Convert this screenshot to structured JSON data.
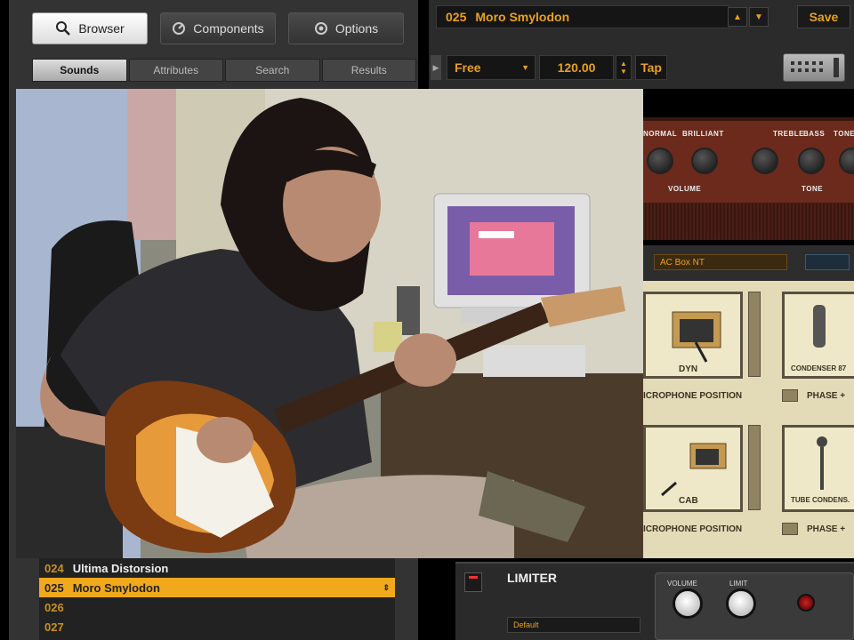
{
  "browser": {
    "tabs": [
      {
        "label": "Browser",
        "icon": "search-icon"
      },
      {
        "label": "Components",
        "icon": "components-icon"
      },
      {
        "label": "Options",
        "icon": "options-icon"
      }
    ],
    "subtabs": [
      "Sounds",
      "Attributes",
      "Search",
      "Results"
    ]
  },
  "header": {
    "preset_number": "025",
    "preset_name": "Moro Smylodon",
    "save_label": "Save",
    "tempo_mode": "Free",
    "tempo": "120.00",
    "tap_label": "Tap"
  },
  "amp": {
    "labels": [
      "NORMAL",
      "BRILLIANT",
      "TREBLE",
      "BASS",
      "TONE"
    ],
    "bottom_labels": [
      "VOLUME",
      "TONE"
    ]
  },
  "cabinet": {
    "select_value": "AC Box NT",
    "slot_captions": [
      "DYN",
      "CONDENSER 87",
      "CAB",
      "TUBE CONDENS."
    ],
    "mic_position_label": "ICROPHONE POSITION",
    "phase_label": "PHASE +"
  },
  "preset_list": [
    {
      "number": "024",
      "name": "Ultima Distorsion"
    },
    {
      "number": "025",
      "name": "Moro Smylodon",
      "selected": true
    },
    {
      "number": "026",
      "name": ""
    },
    {
      "number": "027",
      "name": ""
    }
  ],
  "limiter": {
    "title": "LIMITER",
    "preset": "Default",
    "knob_labels": [
      "VOLUME",
      "LIMIT"
    ]
  },
  "colors": {
    "accent": "#e8a020",
    "panel": "#333333",
    "amp": "#6b2a1c",
    "cabinet": "#e3dbb8"
  }
}
